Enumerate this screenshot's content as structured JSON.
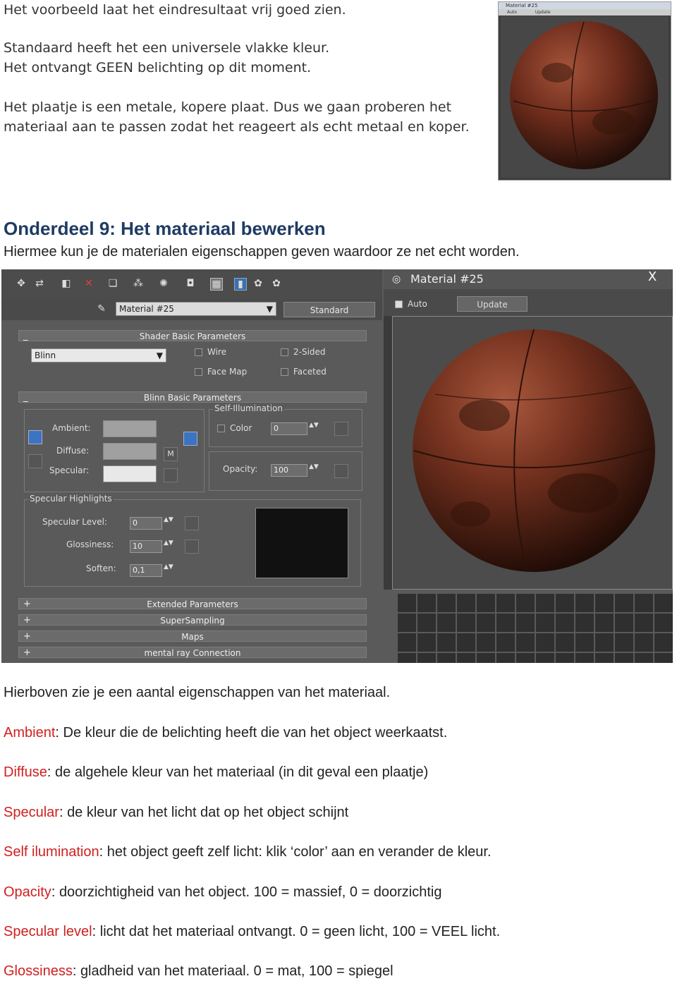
{
  "intro": [
    "Het voorbeeld laat het eindresultaat vrij goed zien.",
    "Standaard heeft het een universele vlakke kleur.",
    "Het ontvangt GEEN belichting op dit moment.",
    "Het plaatje is een metale, kopere plaat. Dus we gaan proberen het",
    "materiaal aan te passen zodat het reageert als echt metaal en koper."
  ],
  "mini_preview": {
    "title": "Material #25",
    "auto": "Auto",
    "update": "Update"
  },
  "section": {
    "heading": "Onderdeel 9: Het materiaal bewerken",
    "subtitle": "Hiermee kun je de materialen eigenschappen geven waardoor ze net echt worden."
  },
  "editor": {
    "material_name": "Material #25",
    "standard_button": "Standard",
    "shader_rollout": "Shader Basic Parameters",
    "shader_value": "Blinn",
    "wire": "Wire",
    "two_sided": "2-Sided",
    "face_map": "Face Map",
    "faceted": "Faceted",
    "blinn_rollout": "Blinn Basic Parameters",
    "self_illumination": "Self-Illumination",
    "color_label": "Color",
    "color_value": "0",
    "ambient": "Ambient:",
    "diffuse": "Diffuse:",
    "specular": "Specular:",
    "m_button": "M",
    "opacity_label": "Opacity:",
    "opacity_value": "100",
    "specular_highlights": "Specular Highlights",
    "spec_level_label": "Specular Level:",
    "spec_level_value": "0",
    "glossiness_label": "Glossiness:",
    "glossiness_value": "10",
    "soften_label": "Soften:",
    "soften_value": "0,1",
    "rollouts": [
      "Extended Parameters",
      "SuperSampling",
      "Maps",
      "mental ray Connection"
    ],
    "preview_title": "Material #25",
    "preview_auto": "Auto",
    "preview_update": "Update",
    "close": "X"
  },
  "after_text": "Hierboven zie je een aantal eigenschappen van het materiaal.",
  "definitions": [
    {
      "term": "Ambient",
      "sep": ": ",
      "desc": "De kleur die de belichting heeft die van het object weerkaatst."
    },
    {
      "term": "Diffuse",
      "sep": ": ",
      "desc": "de algehele kleur van het materiaal (in dit geval een plaatje)"
    },
    {
      "term": "Specular",
      "sep": ": ",
      "desc": "de kleur van het licht dat op het object schijnt"
    },
    {
      "term": "Self ilumination",
      "sep": ": ",
      "desc": "het object geeft zelf licht: klik ‘color’ aan en verander de kleur."
    },
    {
      "term": "Opacity",
      "sep": ": ",
      "desc": "doorzichtigheid van het object. 100 = massief, 0 = doorzichtig"
    },
    {
      "term": "Specular level",
      "sep": ": ",
      "desc": "licht dat het materiaal ontvangt. 0 = geen licht, 100 = VEEL licht."
    },
    {
      "term": "Glossiness",
      "sep": ": ",
      "desc": "gladheid van het materiaal. 0 = mat, 100 = spiegel"
    }
  ],
  "colors": {
    "heading": "#1f3b63",
    "term": "#d02020",
    "copper": "#8a3a24"
  }
}
